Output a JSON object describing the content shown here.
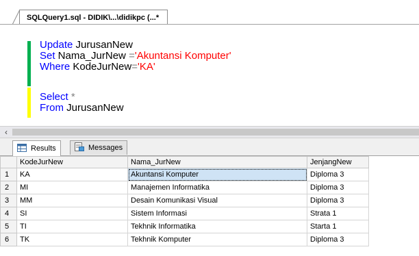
{
  "document_tab": {
    "title": "SQLQuery1.sql - DIDIK\\...\\didikpc (...*"
  },
  "editor": {
    "lines": [
      {
        "keyword": "Update",
        "rest": " JurusanNew"
      },
      {
        "keyword": "Set",
        "ident": " Nama_JurNew ",
        "op": "=",
        "string": "'Akuntansi Komputer'"
      },
      {
        "keyword": "Where",
        "ident": " KodeJurNew",
        "op": "=",
        "string": "'KA'"
      },
      {
        "keyword": "Select",
        "op": " *"
      },
      {
        "keyword": "From",
        "rest": " JurusanNew"
      }
    ],
    "change_bar_colors": [
      "#00b050",
      "#ffff00"
    ]
  },
  "scrollbar": {
    "left_arrow": "‹"
  },
  "result_tabs": [
    {
      "label": "Results",
      "icon": "grid-icon",
      "active": true
    },
    {
      "label": "Messages",
      "icon": "messages-icon",
      "active": false
    }
  ],
  "results": {
    "columns": [
      "KodeJurNew",
      "Nama_JurNew",
      "JenjangNew"
    ],
    "rows": [
      {
        "n": "1",
        "cells": [
          "KA",
          "Akuntansi Komputer",
          "Diploma 3"
        ]
      },
      {
        "n": "2",
        "cells": [
          "MI",
          "Manajemen Informatika",
          "Diploma 3"
        ]
      },
      {
        "n": "3",
        "cells": [
          "MM",
          "Desain Komunikasi Visual",
          "Diploma 3"
        ]
      },
      {
        "n": "4",
        "cells": [
          "SI",
          "Sistem Informasi",
          "Strata 1"
        ]
      },
      {
        "n": "5",
        "cells": [
          "TI",
          "Tekhnik Informatika",
          "Starta 1"
        ]
      },
      {
        "n": "6",
        "cells": [
          "TK",
          "Tekhnik Komputer",
          "Diploma 3"
        ]
      }
    ],
    "selected_cell": "0.1"
  }
}
